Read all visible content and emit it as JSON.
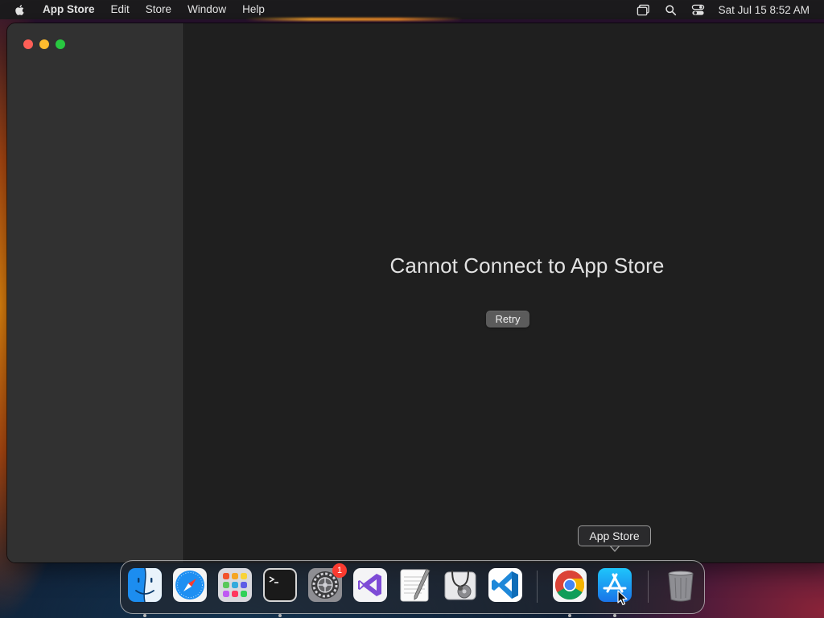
{
  "menubar": {
    "app_name": "App Store",
    "items": [
      "Edit",
      "Store",
      "Window",
      "Help"
    ],
    "clock": "Sat Jul 15  8:52 AM",
    "status_icons": [
      "screen-mirroring-icon",
      "spotlight-search-icon",
      "control-center-icon"
    ]
  },
  "window": {
    "error_title": "Cannot Connect to App Store",
    "retry_label": "Retry"
  },
  "dock": {
    "tooltip": "App Store",
    "items": [
      {
        "name": "Finder",
        "icon": "finder-icon",
        "running": true
      },
      {
        "name": "Safari",
        "icon": "safari-icon",
        "running": false
      },
      {
        "name": "Launchpad",
        "icon": "launchpad-icon",
        "running": false
      },
      {
        "name": "Terminal",
        "icon": "terminal-icon",
        "running": true
      },
      {
        "name": "System Settings",
        "icon": "system-settings-icon",
        "running": false,
        "badge": "1"
      },
      {
        "name": "Visual Studio",
        "icon": "visual-studio-icon",
        "running": false
      },
      {
        "name": "TextEdit",
        "icon": "textedit-icon",
        "running": false
      },
      {
        "name": "Disk Utility",
        "icon": "disk-utility-icon",
        "running": false
      },
      {
        "name": "Visual Studio Code",
        "icon": "vscode-icon",
        "running": false
      },
      {
        "name": "Google Chrome",
        "icon": "chrome-icon",
        "running": true
      },
      {
        "name": "App Store",
        "icon": "app-store-icon",
        "running": true
      },
      {
        "name": "Trash",
        "icon": "trash-icon",
        "running": false
      }
    ]
  },
  "colors": {
    "close": "#fe5f57",
    "minimize": "#febc2e",
    "maximize": "#28c840",
    "badge": "#fb3b30"
  }
}
